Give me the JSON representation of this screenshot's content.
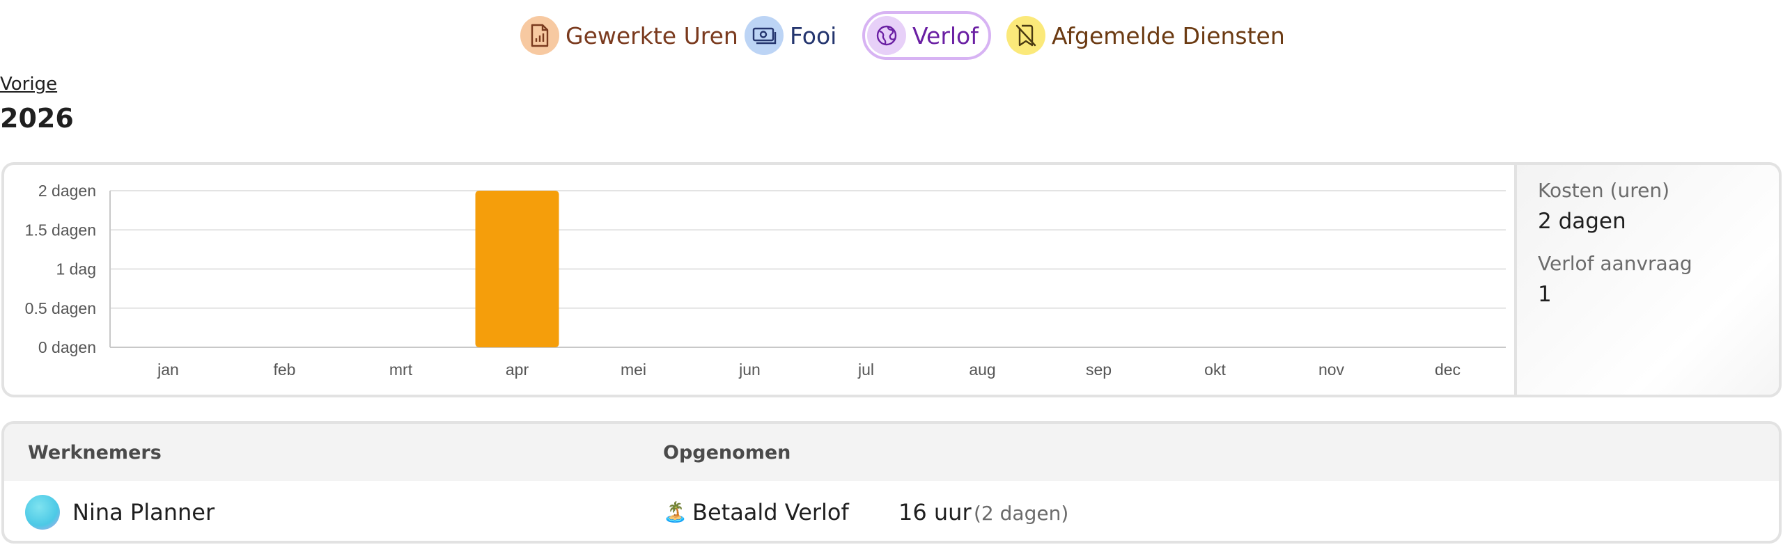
{
  "tabs": [
    {
      "label": "Gewerkte Uren",
      "icon": "report-icon",
      "text_color": "#7a3a1e",
      "icon_bg": "#f7c9a1",
      "active": false
    },
    {
      "label": "Fooi",
      "icon": "money-icon",
      "text_color": "#24356e",
      "icon_bg": "#bcd4f5",
      "active": false
    },
    {
      "label": "Verlof",
      "icon": "globe-icon",
      "text_color": "#6a1fa3",
      "icon_bg": "#e7d0f8",
      "active": true
    },
    {
      "label": "Afgemelde Diensten",
      "icon": "no-bookmark-icon",
      "text_color": "#6b3a12",
      "icon_bg": "#fbe97a",
      "active": false
    }
  ],
  "nav": {
    "previous_label": "Vorige",
    "year": "2026"
  },
  "chart_data": {
    "type": "bar",
    "categories": [
      "jan",
      "feb",
      "mrt",
      "apr",
      "mei",
      "jun",
      "jul",
      "aug",
      "sep",
      "okt",
      "nov",
      "dec"
    ],
    "values": [
      0,
      0,
      0,
      2,
      0,
      0,
      0,
      0,
      0,
      0,
      0,
      0
    ],
    "y_ticks": [
      0,
      0.5,
      1,
      1.5,
      2
    ],
    "y_tick_labels": [
      "0 dagen",
      "0.5 dagen",
      "1 dag",
      "1.5 dagen",
      "2 dagen"
    ],
    "ylim": [
      0,
      2
    ],
    "bar_color": "#f59e0b",
    "grid": true
  },
  "summary": {
    "cost_label": "Kosten (uren)",
    "cost_value": "2 dagen",
    "requests_label": "Verlof aanvraag",
    "requests_value": "1"
  },
  "table": {
    "headers": {
      "employees": "Werknemers",
      "taken": "Opgenomen"
    },
    "rows": [
      {
        "employee": "Nina Planner",
        "leave_emoji": "🏝️",
        "leave_type": "Betaald Verlof",
        "hours": "16 uur",
        "days": "(2 dagen)"
      }
    ]
  }
}
